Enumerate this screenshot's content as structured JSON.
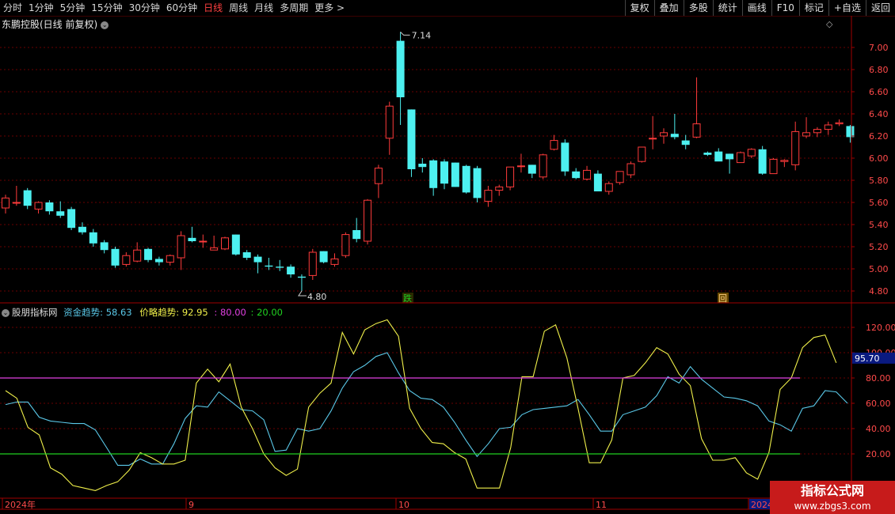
{
  "toolbar": {
    "periods": [
      "分时",
      "1分钟",
      "5分钟",
      "15分钟",
      "30分钟",
      "60分钟",
      "日线",
      "周线",
      "月线",
      "多周期",
      "更多 >"
    ],
    "active_period": "日线",
    "buttons": [
      "复权",
      "叠加",
      "多股",
      "统计",
      "画线",
      "F10",
      "标记",
      "+自选",
      "返回"
    ]
  },
  "main_chart": {
    "title": "东鹏控股(日线 前复权)",
    "high_label": "7.14",
    "low_label": "4.80",
    "signal_labels": [
      "跌",
      "回"
    ]
  },
  "indicator": {
    "name": "股朋指标网",
    "line1_label": "资金趋势:",
    "line1_value": "58.63",
    "line2_label": "价略趋势:",
    "line2_value": "92.95",
    "level_high": "80.00",
    "level_low": "20.00",
    "current_value": "95.70"
  },
  "x_axis": [
    "2024年",
    "9",
    "10",
    "11",
    "2024"
  ],
  "watermark": {
    "line1": "指标公式网",
    "line2": "www.zbgs3.com"
  },
  "colors": {
    "up": "#ff3b3b",
    "down": "#4df0f0",
    "line_cyan": "#5ac8e8",
    "line_yellow": "#f0f04a",
    "level_magenta": "#e040e0",
    "level_green": "#20d020"
  },
  "chart_data": [
    {
      "type": "candlestick",
      "title": "东鹏控股(日线 前复权)",
      "ylim": [
        4.7,
        7.3
      ],
      "y_ticks": [
        "7.00",
        "6.80",
        "6.60",
        "6.40",
        "6.20",
        "6.00",
        "5.80",
        "5.60",
        "5.40",
        "5.20",
        "5.00",
        "4.80"
      ],
      "candles": [
        {
          "o": 5.55,
          "h": 5.67,
          "l": 5.5,
          "c": 5.64
        },
        {
          "o": 5.6,
          "h": 5.75,
          "l": 5.57,
          "c": 5.6
        },
        {
          "o": 5.71,
          "h": 5.73,
          "l": 5.54,
          "c": 5.57
        },
        {
          "o": 5.54,
          "h": 5.61,
          "l": 5.5,
          "c": 5.6
        },
        {
          "o": 5.6,
          "h": 5.62,
          "l": 5.49,
          "c": 5.52
        },
        {
          "o": 5.52,
          "h": 5.61,
          "l": 5.46,
          "c": 5.48
        },
        {
          "o": 5.54,
          "h": 5.56,
          "l": 5.35,
          "c": 5.37
        },
        {
          "o": 5.38,
          "h": 5.42,
          "l": 5.31,
          "c": 5.33
        },
        {
          "o": 5.33,
          "h": 5.36,
          "l": 5.2,
          "c": 5.23
        },
        {
          "o": 5.24,
          "h": 5.26,
          "l": 5.14,
          "c": 5.17
        },
        {
          "o": 5.18,
          "h": 5.2,
          "l": 5.01,
          "c": 5.03
        },
        {
          "o": 5.04,
          "h": 5.15,
          "l": 5.02,
          "c": 5.12
        },
        {
          "o": 5.07,
          "h": 5.24,
          "l": 5.06,
          "c": 5.17
        },
        {
          "o": 5.18,
          "h": 5.19,
          "l": 5.06,
          "c": 5.08
        },
        {
          "o": 5.09,
          "h": 5.11,
          "l": 5.03,
          "c": 5.06
        },
        {
          "o": 5.06,
          "h": 5.13,
          "l": 5.03,
          "c": 5.12
        },
        {
          "o": 5.1,
          "h": 5.34,
          "l": 4.99,
          "c": 5.3
        },
        {
          "o": 5.28,
          "h": 5.38,
          "l": 5.24,
          "c": 5.25
        },
        {
          "o": 5.25,
          "h": 5.31,
          "l": 5.19,
          "c": 5.25
        },
        {
          "o": 5.17,
          "h": 5.3,
          "l": 5.17,
          "c": 5.19
        },
        {
          "o": 5.18,
          "h": 5.29,
          "l": 5.17,
          "c": 5.28
        },
        {
          "o": 5.31,
          "h": 5.31,
          "l": 5.12,
          "c": 5.13
        },
        {
          "o": 5.15,
          "h": 5.17,
          "l": 5.08,
          "c": 5.1
        },
        {
          "o": 5.11,
          "h": 5.13,
          "l": 4.96,
          "c": 5.06
        },
        {
          "o": 5.03,
          "h": 5.1,
          "l": 4.99,
          "c": 5.02
        },
        {
          "o": 5.02,
          "h": 5.08,
          "l": 4.98,
          "c": 5.01
        },
        {
          "o": 5.02,
          "h": 5.04,
          "l": 4.92,
          "c": 4.95
        },
        {
          "o": 4.93,
          "h": 4.95,
          "l": 4.8,
          "c": 4.92
        },
        {
          "o": 4.94,
          "h": 5.18,
          "l": 4.9,
          "c": 5.15
        },
        {
          "o": 5.16,
          "h": 5.16,
          "l": 5.05,
          "c": 5.06
        },
        {
          "o": 5.04,
          "h": 5.14,
          "l": 5.02,
          "c": 5.09
        },
        {
          "o": 5.12,
          "h": 5.33,
          "l": 5.1,
          "c": 5.31
        },
        {
          "o": 5.35,
          "h": 5.46,
          "l": 5.24,
          "c": 5.27
        },
        {
          "o": 5.25,
          "h": 5.63,
          "l": 5.22,
          "c": 5.62
        },
        {
          "o": 5.77,
          "h": 5.94,
          "l": 5.64,
          "c": 5.91
        },
        {
          "o": 6.18,
          "h": 6.51,
          "l": 6.03,
          "c": 6.47
        },
        {
          "o": 7.06,
          "h": 7.14,
          "l": 6.3,
          "c": 6.55
        },
        {
          "o": 6.44,
          "h": 6.44,
          "l": 5.83,
          "c": 5.9
        },
        {
          "o": 5.95,
          "h": 6.0,
          "l": 5.87,
          "c": 5.92
        },
        {
          "o": 5.98,
          "h": 5.99,
          "l": 5.66,
          "c": 5.73
        },
        {
          "o": 5.97,
          "h": 5.99,
          "l": 5.72,
          "c": 5.77
        },
        {
          "o": 5.96,
          "h": 5.96,
          "l": 5.74,
          "c": 5.74
        },
        {
          "o": 5.93,
          "h": 5.94,
          "l": 5.68,
          "c": 5.69
        },
        {
          "o": 5.91,
          "h": 5.93,
          "l": 5.6,
          "c": 5.64
        },
        {
          "o": 5.61,
          "h": 5.75,
          "l": 5.56,
          "c": 5.71
        },
        {
          "o": 5.71,
          "h": 5.76,
          "l": 5.66,
          "c": 5.74
        },
        {
          "o": 5.74,
          "h": 5.92,
          "l": 5.71,
          "c": 5.92
        },
        {
          "o": 5.93,
          "h": 6.04,
          "l": 5.87,
          "c": 5.93
        },
        {
          "o": 5.94,
          "h": 5.94,
          "l": 5.82,
          "c": 5.86
        },
        {
          "o": 5.83,
          "h": 6.04,
          "l": 5.81,
          "c": 6.03
        },
        {
          "o": 6.08,
          "h": 6.21,
          "l": 6.07,
          "c": 6.16
        },
        {
          "o": 6.14,
          "h": 6.17,
          "l": 5.84,
          "c": 5.88
        },
        {
          "o": 5.88,
          "h": 5.91,
          "l": 5.81,
          "c": 5.82
        },
        {
          "o": 5.81,
          "h": 5.93,
          "l": 5.8,
          "c": 5.89
        },
        {
          "o": 5.86,
          "h": 5.89,
          "l": 5.7,
          "c": 5.7
        },
        {
          "o": 5.7,
          "h": 5.79,
          "l": 5.67,
          "c": 5.77
        },
        {
          "o": 5.78,
          "h": 5.88,
          "l": 5.76,
          "c": 5.88
        },
        {
          "o": 5.85,
          "h": 5.97,
          "l": 5.82,
          "c": 5.95
        },
        {
          "o": 5.97,
          "h": 6.1,
          "l": 5.96,
          "c": 6.1
        },
        {
          "o": 6.18,
          "h": 6.38,
          "l": 6.08,
          "c": 6.18
        },
        {
          "o": 6.2,
          "h": 6.27,
          "l": 6.13,
          "c": 6.23
        },
        {
          "o": 6.22,
          "h": 6.4,
          "l": 6.17,
          "c": 6.19
        },
        {
          "o": 6.16,
          "h": 6.21,
          "l": 6.08,
          "c": 6.12
        },
        {
          "o": 6.19,
          "h": 6.73,
          "l": 6.18,
          "c": 6.31
        },
        {
          "o": 6.05,
          "h": 6.06,
          "l": 6.02,
          "c": 6.03
        },
        {
          "o": 6.06,
          "h": 6.09,
          "l": 5.98,
          "c": 5.97
        },
        {
          "o": 6.04,
          "h": 6.04,
          "l": 5.86,
          "c": 5.99
        },
        {
          "o": 5.96,
          "h": 6.06,
          "l": 5.96,
          "c": 6.05
        },
        {
          "o": 6.02,
          "h": 6.09,
          "l": 6.0,
          "c": 6.08
        },
        {
          "o": 6.08,
          "h": 6.11,
          "l": 5.85,
          "c": 5.86
        },
        {
          "o": 5.86,
          "h": 6.0,
          "l": 5.86,
          "c": 5.99
        },
        {
          "o": 5.97,
          "h": 5.99,
          "l": 5.92,
          "c": 5.98
        },
        {
          "o": 5.94,
          "h": 6.33,
          "l": 5.89,
          "c": 6.24
        },
        {
          "o": 6.2,
          "h": 6.37,
          "l": 6.18,
          "c": 6.23
        },
        {
          "o": 6.23,
          "h": 6.28,
          "l": 6.19,
          "c": 6.26
        },
        {
          "o": 6.26,
          "h": 6.33,
          "l": 6.21,
          "c": 6.3
        },
        {
          "o": 6.31,
          "h": 6.35,
          "l": 6.29,
          "c": 6.32
        },
        {
          "o": 6.29,
          "h": 6.3,
          "l": 6.14,
          "c": 6.19
        }
      ]
    },
    {
      "type": "line",
      "title": "股朋指标网",
      "ylim": [
        -10,
        140
      ],
      "y_ticks": [
        "120.00",
        "100.00",
        "80.00",
        "60.00",
        "40.00",
        "20.00"
      ],
      "series": [
        {
          "name": "资金趋势",
          "values": [
            59,
            61,
            61,
            49,
            46,
            45,
            44,
            44,
            39,
            25,
            11,
            11,
            16,
            12,
            12,
            28,
            48,
            58,
            57,
            69,
            62,
            55,
            54,
            47,
            22,
            23,
            40,
            38,
            40,
            54,
            72,
            85,
            90,
            97,
            100,
            84,
            70,
            64,
            63,
            57,
            45,
            31,
            18,
            28,
            40,
            41,
            51,
            55,
            56,
            57,
            58,
            63,
            51,
            38,
            38,
            51,
            54,
            57,
            66,
            81,
            76,
            89,
            79,
            72,
            65,
            64,
            62,
            58,
            46,
            43,
            38,
            56,
            58,
            70,
            69,
            60
          ]
        },
        {
          "name": "价略趋势",
          "values": [
            70,
            64,
            41,
            35,
            9,
            4,
            -5,
            -7,
            -9,
            -5,
            -2,
            7,
            21,
            17,
            12,
            12,
            15,
            76,
            87,
            77,
            91,
            57,
            40,
            20,
            9,
            3,
            8,
            57,
            68,
            76,
            116,
            99,
            118,
            123,
            126,
            113,
            56,
            40,
            29,
            28,
            21,
            16,
            -7,
            -7,
            -7,
            25,
            81,
            81,
            117,
            122,
            96,
            56,
            13,
            13,
            31,
            80,
            82,
            92,
            104,
            99,
            83,
            74,
            32,
            15,
            15,
            17,
            5,
            0,
            21,
            71,
            80,
            104,
            112,
            114,
            92
          ]
        },
        {
          "name": "80.00",
          "values": [
            80
          ]
        },
        {
          "name": "20.00",
          "values": [
            20
          ]
        }
      ]
    }
  ]
}
